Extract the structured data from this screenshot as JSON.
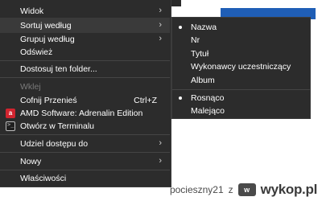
{
  "menu": {
    "items": [
      {
        "label": "Widok",
        "arrow": "›"
      },
      {
        "label": "Sortuj według",
        "arrow": "›"
      },
      {
        "label": "Grupuj według",
        "arrow": "›"
      },
      {
        "label": "Odśwież"
      },
      {
        "label": "Dostosuj ten folder..."
      },
      {
        "label": "Wklej"
      },
      {
        "label": "Cofnij Przenieś",
        "shortcut": "Ctrl+Z"
      },
      {
        "label": "AMD Software: Adrenalin Edition",
        "icon": "amd-logo-icon"
      },
      {
        "label": "Otwórz w Terminalu",
        "icon": "terminal-icon"
      },
      {
        "label": "Udziel dostępu do",
        "arrow": "›"
      },
      {
        "label": "Nowy",
        "arrow": "›"
      },
      {
        "label": "Właściwości"
      }
    ]
  },
  "submenu": {
    "items": [
      {
        "label": "Nazwa",
        "selected": true
      },
      {
        "label": "Nr"
      },
      {
        "label": "Tytuł"
      },
      {
        "label": "Wykonawcy uczestniczący"
      },
      {
        "label": "Album"
      },
      {
        "label": "Rosnąco",
        "selected": true
      },
      {
        "label": "Malejąco"
      }
    ]
  },
  "watermark": {
    "user": "pocieszny21",
    "sep": "z",
    "site": "wykop.pl"
  },
  "colors": {
    "menu_bg": "#2c2c2c",
    "accent_blue": "#1f5eb6",
    "amd_red": "#d1242f"
  }
}
